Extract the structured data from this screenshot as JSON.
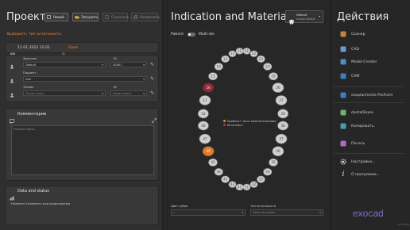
{
  "left": {
    "title": "Проект",
    "toolbar": {
      "new": "Новый",
      "load": "Загрузить",
      "save": "Сохранить",
      "copy": "Копировать"
    },
    "warning": "Выберите: Тип антагониста",
    "date": {
      "value": "11.01.2022 12:01",
      "status": "Open"
    },
    "fields": {
      "customer_label": "Заказчик",
      "customer_value": "Default",
      "id_label": "ID",
      "id_value": "00001",
      "patient_label": "Пациент",
      "patient_value": "test",
      "technician_label": "Техник",
      "technician_placeholder": "Please select",
      "id2_label": "ID",
      "id2_placeholder": "Please select"
    },
    "comments": {
      "title": "Комментарии",
      "placeholder": "Комментарии..."
    },
    "status": {
      "title": "Data and status",
      "text": "Нажмите Сохранить для продолжения"
    }
  },
  "center": {
    "title": "Indication and Materials",
    "default_btn": {
      "line1": "Default",
      "line2": "exocad default"
    },
    "toggle": {
      "left": "Patient",
      "right": "Multi-die"
    },
    "legend": {
      "line1": "Примечат. часть нижней анатомии",
      "line2": "Антагонист"
    },
    "upper_teeth": [
      "18",
      "17",
      "16",
      "15",
      "14",
      "13",
      "12",
      "11",
      "21",
      "22",
      "23",
      "24",
      "25",
      "26",
      "27",
      "28"
    ],
    "lower_teeth": [
      "48",
      "47",
      "46",
      "45",
      "44",
      "43",
      "42",
      "41",
      "31",
      "32",
      "33",
      "34",
      "35",
      "36",
      "37",
      "38"
    ],
    "selected_upper": "16",
    "selected_lower": "46",
    "bottom": {
      "teeth_label": "Цвет зубов",
      "teeth_value": "--",
      "antagonist_label": "Тип антагониста",
      "antagonist_placeholder": "Select an option"
    }
  },
  "right": {
    "title": "Действия",
    "actions": [
      {
        "label": "Сканер",
        "icon": "scanner-icon",
        "color": "#c9843c"
      },
      {
        "label": "CAD",
        "icon": "cad-icon",
        "color": "#6c9ad0"
      },
      {
        "label": "Model Creator",
        "icon": "model-creator-icon",
        "color": "#4f8fbf"
      },
      {
        "label": "CAM",
        "icon": "cam-icon",
        "color": "#3e7ebf"
      },
      {
        "label": "exoplan/smile ProForm",
        "icon": "proform-icon",
        "color": "#3e7ebf"
      },
      {
        "label": "dentalShare",
        "icon": "dentalshare-icon",
        "color": "#6db36d"
      },
      {
        "label": "Копировать",
        "icon": "copy-icon",
        "color": "#4a9ab8"
      },
      {
        "label": "Печать",
        "icon": "print-icon",
        "color": "#b06ac7"
      }
    ],
    "settings": "Настройки...",
    "about": "О программе...",
    "logo": "exocad",
    "version": "v3.0 7822"
  }
}
